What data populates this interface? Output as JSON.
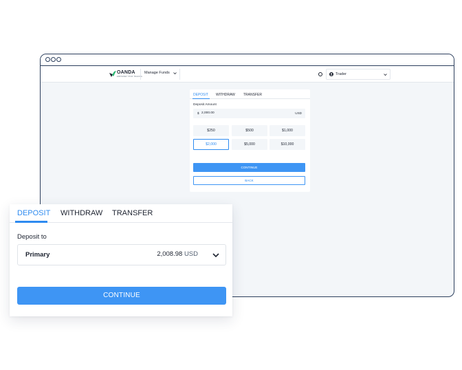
{
  "brand": {
    "name": "OANDA",
    "tagline": "EMPOWER YOUR TRADING",
    "accent": "#2e8bf0"
  },
  "navbar": {
    "manage_funds": "Manage Funds",
    "user_label": "Trader"
  },
  "mini_card": {
    "tabs": [
      "DEPOSIT",
      "WITHDRAW",
      "TRANSFER"
    ],
    "active_tab": "DEPOSIT",
    "amount_label": "Deposit Amount",
    "currency_symbol": "$",
    "amount_value": "2,000.00",
    "currency": "USD",
    "presets": [
      "$250",
      "$500",
      "$1,000",
      "$2,000",
      "$5,000",
      "$10,000"
    ],
    "selected_preset": "$2,000",
    "continue_label": "CONTINUE",
    "back_label": "BACK"
  },
  "big_card": {
    "tabs": [
      "DEPOSIT",
      "WITHDRAW",
      "TRANSFER"
    ],
    "active_tab": "DEPOSIT",
    "deposit_to_label": "Deposit to",
    "account_name": "Primary",
    "balance": "2,008.98",
    "currency": "USD",
    "continue_label": "CONTINUE"
  }
}
